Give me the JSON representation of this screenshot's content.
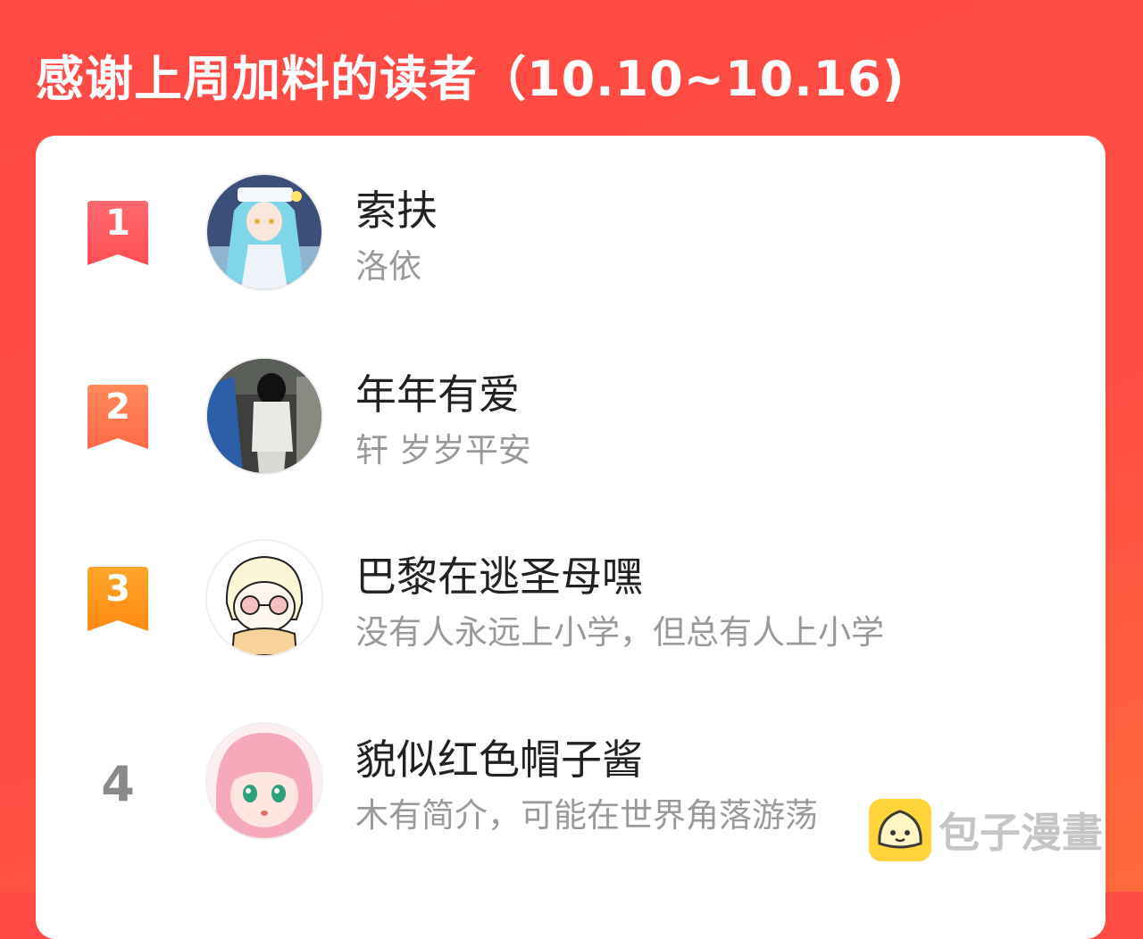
{
  "header": {
    "title": "感谢上周加料的读者（10.10~10.16)"
  },
  "colors": {
    "background": "#ff4a45",
    "rank_1": "#ff5a5e",
    "rank_2": "#ff7a52",
    "rank_3": "#ff9a1f",
    "rank_other": "#8a8a8a"
  },
  "readers": [
    {
      "rank": "1",
      "name": "索扶",
      "bio": "洛依",
      "avatar_icon": "anime-girl-cyan-hair-avatar"
    },
    {
      "rank": "2",
      "name": "年年有爱",
      "bio": "轩 岁岁平安",
      "avatar_icon": "photo-person-back-avatar"
    },
    {
      "rank": "3",
      "name": "巴黎在逃圣母嘿",
      "bio": "没有人永远上小学，但总有人上小学",
      "avatar_icon": "cartoon-glasses-kid-avatar"
    },
    {
      "rank": "4",
      "name": "貌似红色帽子酱",
      "bio": "木有简介，可能在世界角落游荡",
      "avatar_icon": "anime-girl-pink-hair-avatar"
    }
  ],
  "watermark": {
    "text": "包子漫畫",
    "logo_icon": "baozi-bun-logo-icon"
  }
}
